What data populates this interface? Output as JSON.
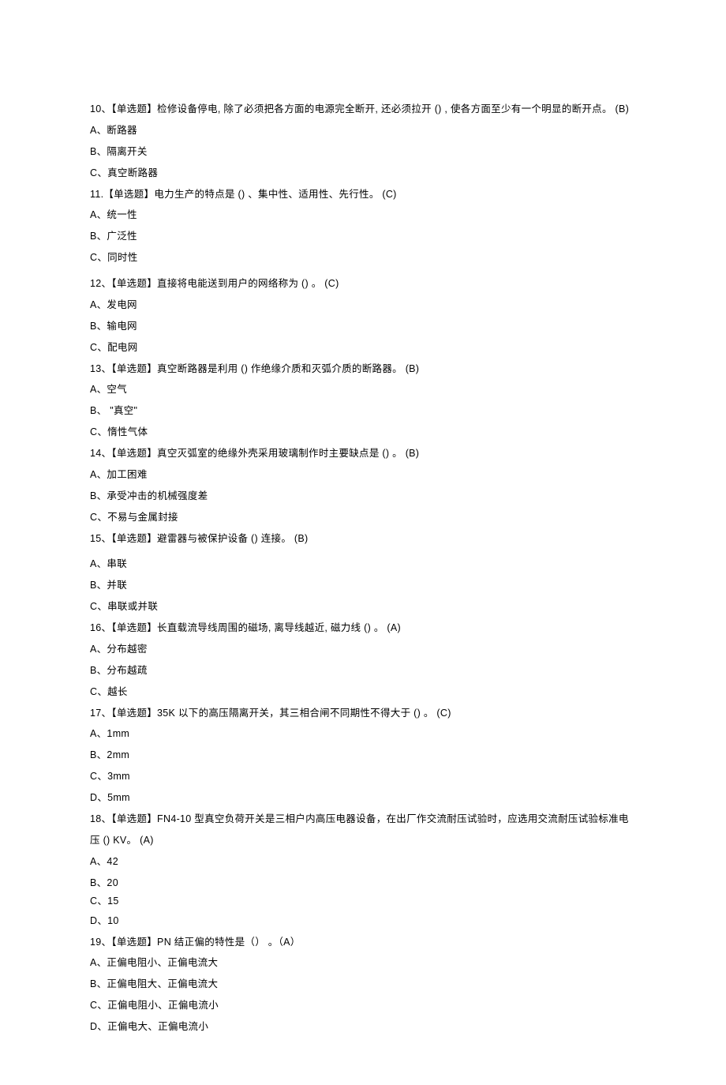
{
  "questions": [
    {
      "q": "10、【单选题】检修设备停电, 除了必须把各方面的电源完全断开, 还必须拉开 () , 使各方面至少有一个明显的断开点。 (B)",
      "options": [
        "A、断路器",
        "B、隔离开关",
        "C、真空断路器"
      ]
    },
    {
      "q": "11.【单选题】电力生产的特点是 () 、集中性、适用性、先行性。 (C)",
      "options": [
        "A、统一性",
        "B、广泛性",
        "C、同时性"
      ]
    },
    {
      "q": "12、【单选题】直接将电能送到用户的网络称为 () 。 (C)",
      "options": [
        "A、发电网",
        "B、输电网",
        "C、配电网"
      ]
    },
    {
      "q": "13、【单选题】真空断路器是利用 () 作绝缘介质和灭弧介质的断路器。 (B)",
      "options": [
        "A、空气",
        "B、 \"真空\"",
        "C、惰性气体"
      ]
    },
    {
      "q": "14、【单选题】真空灭弧室的绝缘外壳采用玻璃制作时主要缺点是 () 。 (B)",
      "options": [
        "A、加工困难",
        "B、承受冲击的机械强度差",
        "C、不易与金属封接"
      ]
    },
    {
      "q": "15、【单选题】避雷器与被保护设备 () 连接。 (B)",
      "options": [
        "A、串联",
        "B、并联",
        "C、串联或并联"
      ]
    },
    {
      "q": "16、【单选题】长直载流导线周围的磁场, 离导线越近, 磁力线 () 。 (A)",
      "options": [
        "A、分布越密",
        "B、分布越疏",
        "C、越长"
      ]
    },
    {
      "q": "17、【单选题】35K 以下的高压隔离开关，其三相合闸不同期性不得大于 () 。 (C)",
      "options": [
        "A、1mm",
        "B、2mm",
        "C、3mm",
        "D、5mm"
      ]
    },
    {
      "q": "18、【单选题】FN4-10 型真空负荷开关是三相户内高压电器设备，在出厂作交流耐压试验时，应选用交流耐压试验标准电压 () KV。 (A)",
      "options": [
        "A、42",
        "B、20",
        "C、15",
        "D、10"
      ]
    },
    {
      "q": "19、【单选题】PN 结正偏的特性是（） 。（A）",
      "options": [
        "A、正偏电阻小、正偏电流大",
        "B、正偏电阻大、正偏电流大",
        "C、正偏电阻小、正偏电流小",
        "D、正偏电大、正偏电流小"
      ]
    }
  ]
}
